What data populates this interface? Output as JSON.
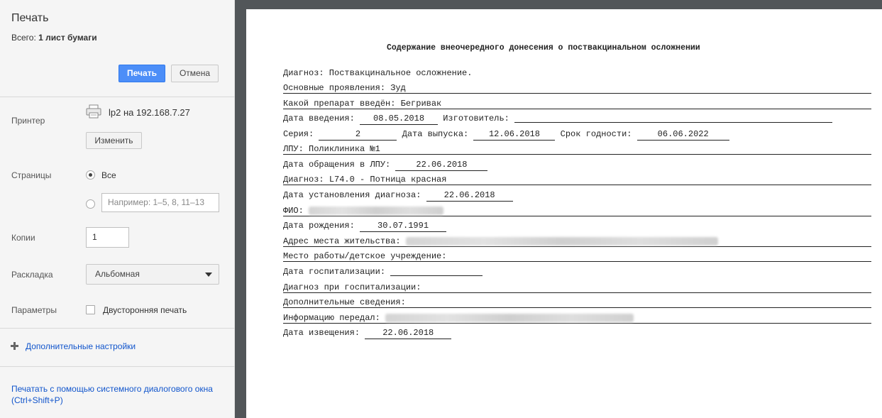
{
  "sidebar": {
    "title": "Печать",
    "total_label": "Всего:",
    "total_value": "1 лист бумаги",
    "print_button": "Печать",
    "cancel_button": "Отмена",
    "printer_label": "Принтер",
    "printer_name": "lp2 на 192.168.7.27",
    "printer_icon": "printer-icon",
    "change_button": "Изменить",
    "pages_label": "Страницы",
    "pages_all": "Все",
    "pages_custom_placeholder": "Например: 1–5, 8, 11–13",
    "copies_label": "Копии",
    "copies_value": "1",
    "layout_label": "Раскладка",
    "layout_value": "Альбомная",
    "options_label": "Параметры",
    "duplex_label": "Двусторонняя печать",
    "more_settings": "Дополнительные настройки",
    "system_dialog": "Печатать с помощью системного диалогового окна (Ctrl+Shift+P)"
  },
  "document": {
    "title": "Содержание внеочередного донесения о поствакцинальном осложнении",
    "diagnosis_line": "Диагноз: Поствакцинальное осложнение.",
    "manifestations_label": "Основные проявления:",
    "manifestations_value": "Зуд",
    "drug_label": "Какой препарат введён:",
    "drug_value": "Бегривак",
    "admin_date_label": "Дата введения:",
    "admin_date_value": "08.05.2018",
    "manufacturer_label": "Изготовитель:",
    "series_label": "Серия:",
    "series_value": "2",
    "release_date_label": "Дата выпуска:",
    "release_date_value": "12.06.2018",
    "expiry_label": "Срок годности:",
    "expiry_value": "06.06.2022",
    "lpu_label": "ЛПУ:",
    "lpu_value": "Поликлиника №1",
    "visit_date_label": "Дата обращения в ЛПУ:",
    "visit_date_value": "22.06.2018",
    "diagnosis2_label": "Диагноз:",
    "diagnosis2_value": "L74.0 - Потница красная",
    "diag_date_label": "Дата установления диагноза:",
    "diag_date_value": "22.06.2018",
    "fio_label": "ФИО:",
    "birth_label": "Дата рождения:",
    "birth_value": "30.07.1991",
    "address_label": "Адрес места жительства:",
    "work_label": "Место работы/детское учреждение:",
    "hosp_date_label": "Дата госпитализации:",
    "hosp_diag_label": "Диагноз при госпитализации:",
    "extra_label": "Дополнительные сведения:",
    "informed_label": "Информацию передал:",
    "notice_date_label": "Дата извещения:",
    "notice_date_value": "22.06.2018"
  }
}
